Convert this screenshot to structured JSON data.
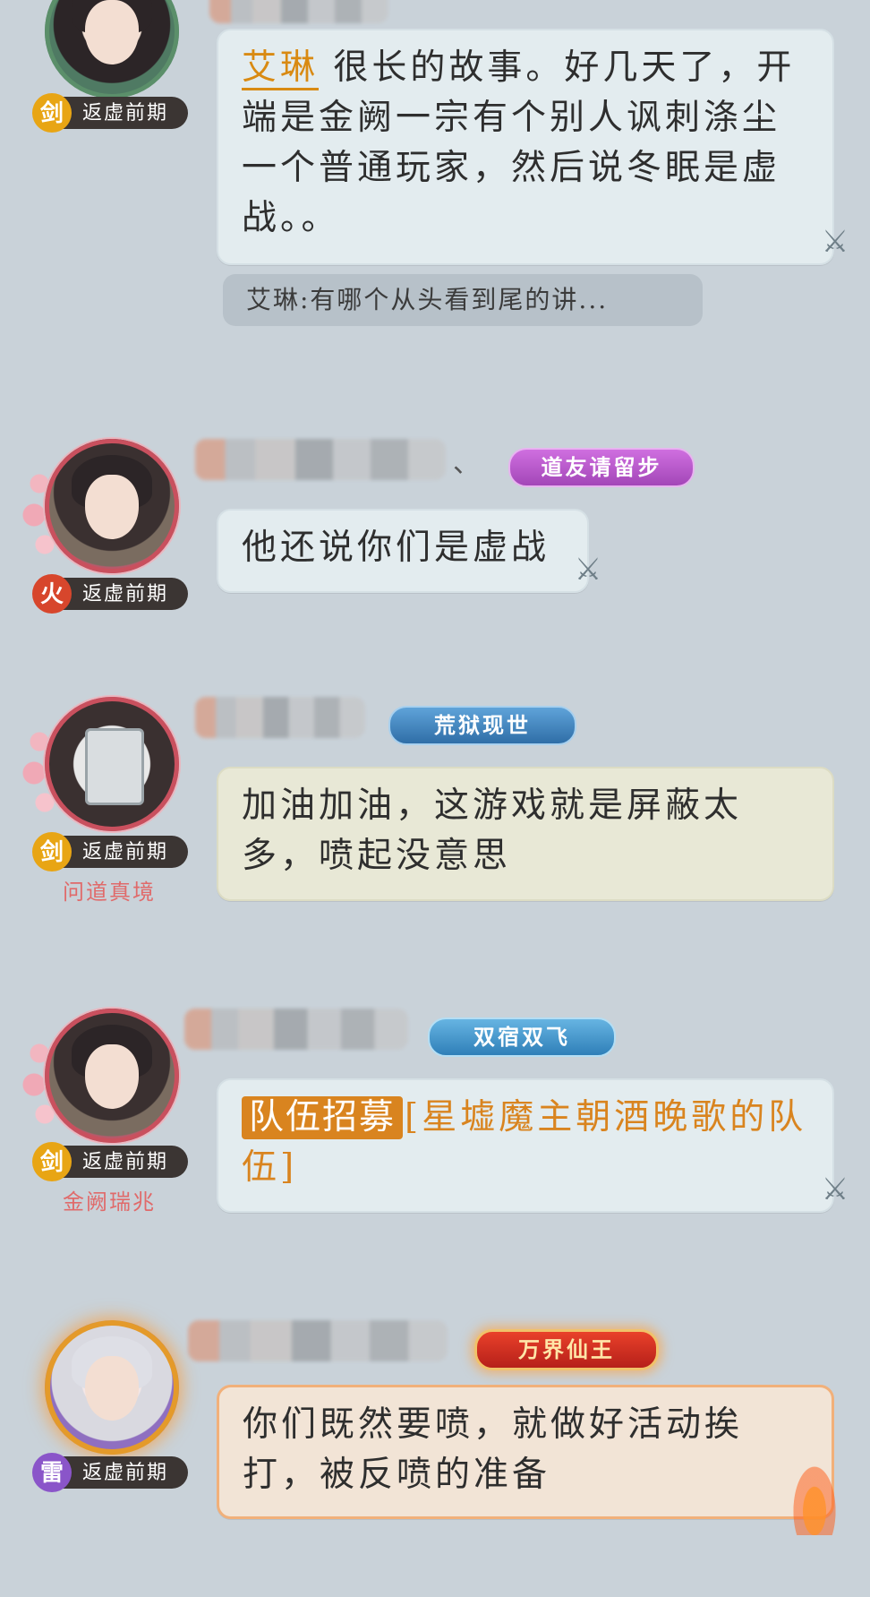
{
  "messages": [
    {
      "rank": "返虚前期",
      "element": "剑",
      "element_color": "#e8a514",
      "mention": "艾琳",
      "text": "很长的故事。好几天了，开端是金阙一宗有个别人讽刺涤尘一个普通玩家，然后说冬眠是虚战。。",
      "quote": "艾琳:有哪个从头看到尾的讲..."
    },
    {
      "rank": "返虚前期",
      "element": "火",
      "element_color": "#d7462c",
      "title_badge": "道友请留步",
      "title_color": "#b956c9",
      "separator": "、",
      "text": "他还说你们是虚战"
    },
    {
      "rank": "返虚前期",
      "element": "剑",
      "element_color": "#e8a514",
      "sect": "问道真境",
      "title_badge": "荒狱现世",
      "title_color": "#3f7fb8",
      "text": "加油加油，这游戏就是屏蔽太多，喷起没意思"
    },
    {
      "rank": "返虚前期",
      "element": "剑",
      "element_color": "#e8a514",
      "sect": "金阙瑞兆",
      "title_badge": "双宿双飞",
      "title_color": "#3e8fc7",
      "recruit_tag": "队伍招募",
      "recruit_text": "[星墟魔主朝酒晚歌的队伍]"
    },
    {
      "rank": "返虚前期",
      "element": "雷",
      "element_color": "#8a55c9",
      "title_badge": "万界仙王",
      "text": "你们既然要喷，就做好活动挨打，被反喷的准备"
    }
  ],
  "icons": {
    "sword": "sword-icon",
    "colors": {
      "bubble_blue": "#e3ecef",
      "bubble_cream": "#e8e8d6",
      "accent_orange": "#d9841f"
    }
  }
}
